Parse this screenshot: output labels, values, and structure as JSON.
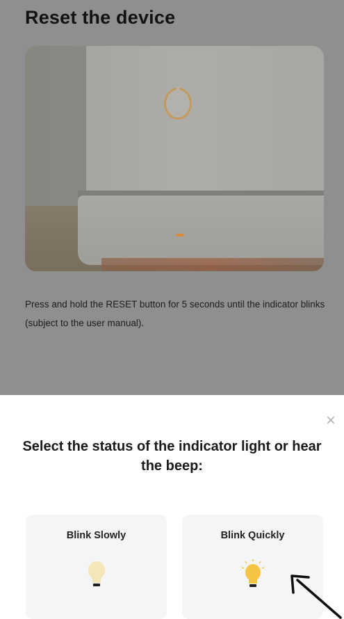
{
  "background_page": {
    "title": "Reset the device",
    "instruction": "Press and hold the RESET button for 5 seconds until the indicator blinks (subject to the user manual)."
  },
  "sheet": {
    "close_icon": "×",
    "title": "Select the status of the indicator light or hear the beep:",
    "options": [
      {
        "label": "Blink Slowly",
        "icon": "bulb-dim-icon",
        "color": "#f3e6b8"
      },
      {
        "label": "Blink Quickly",
        "icon": "bulb-lit-icon",
        "color": "#f6c443"
      }
    ]
  },
  "colors": {
    "overlay": "#8f8f8f",
    "card_bg": "#f4f5f7",
    "bulb_lit": "#f6c443",
    "bulb_dim": "#f3e6b8"
  }
}
